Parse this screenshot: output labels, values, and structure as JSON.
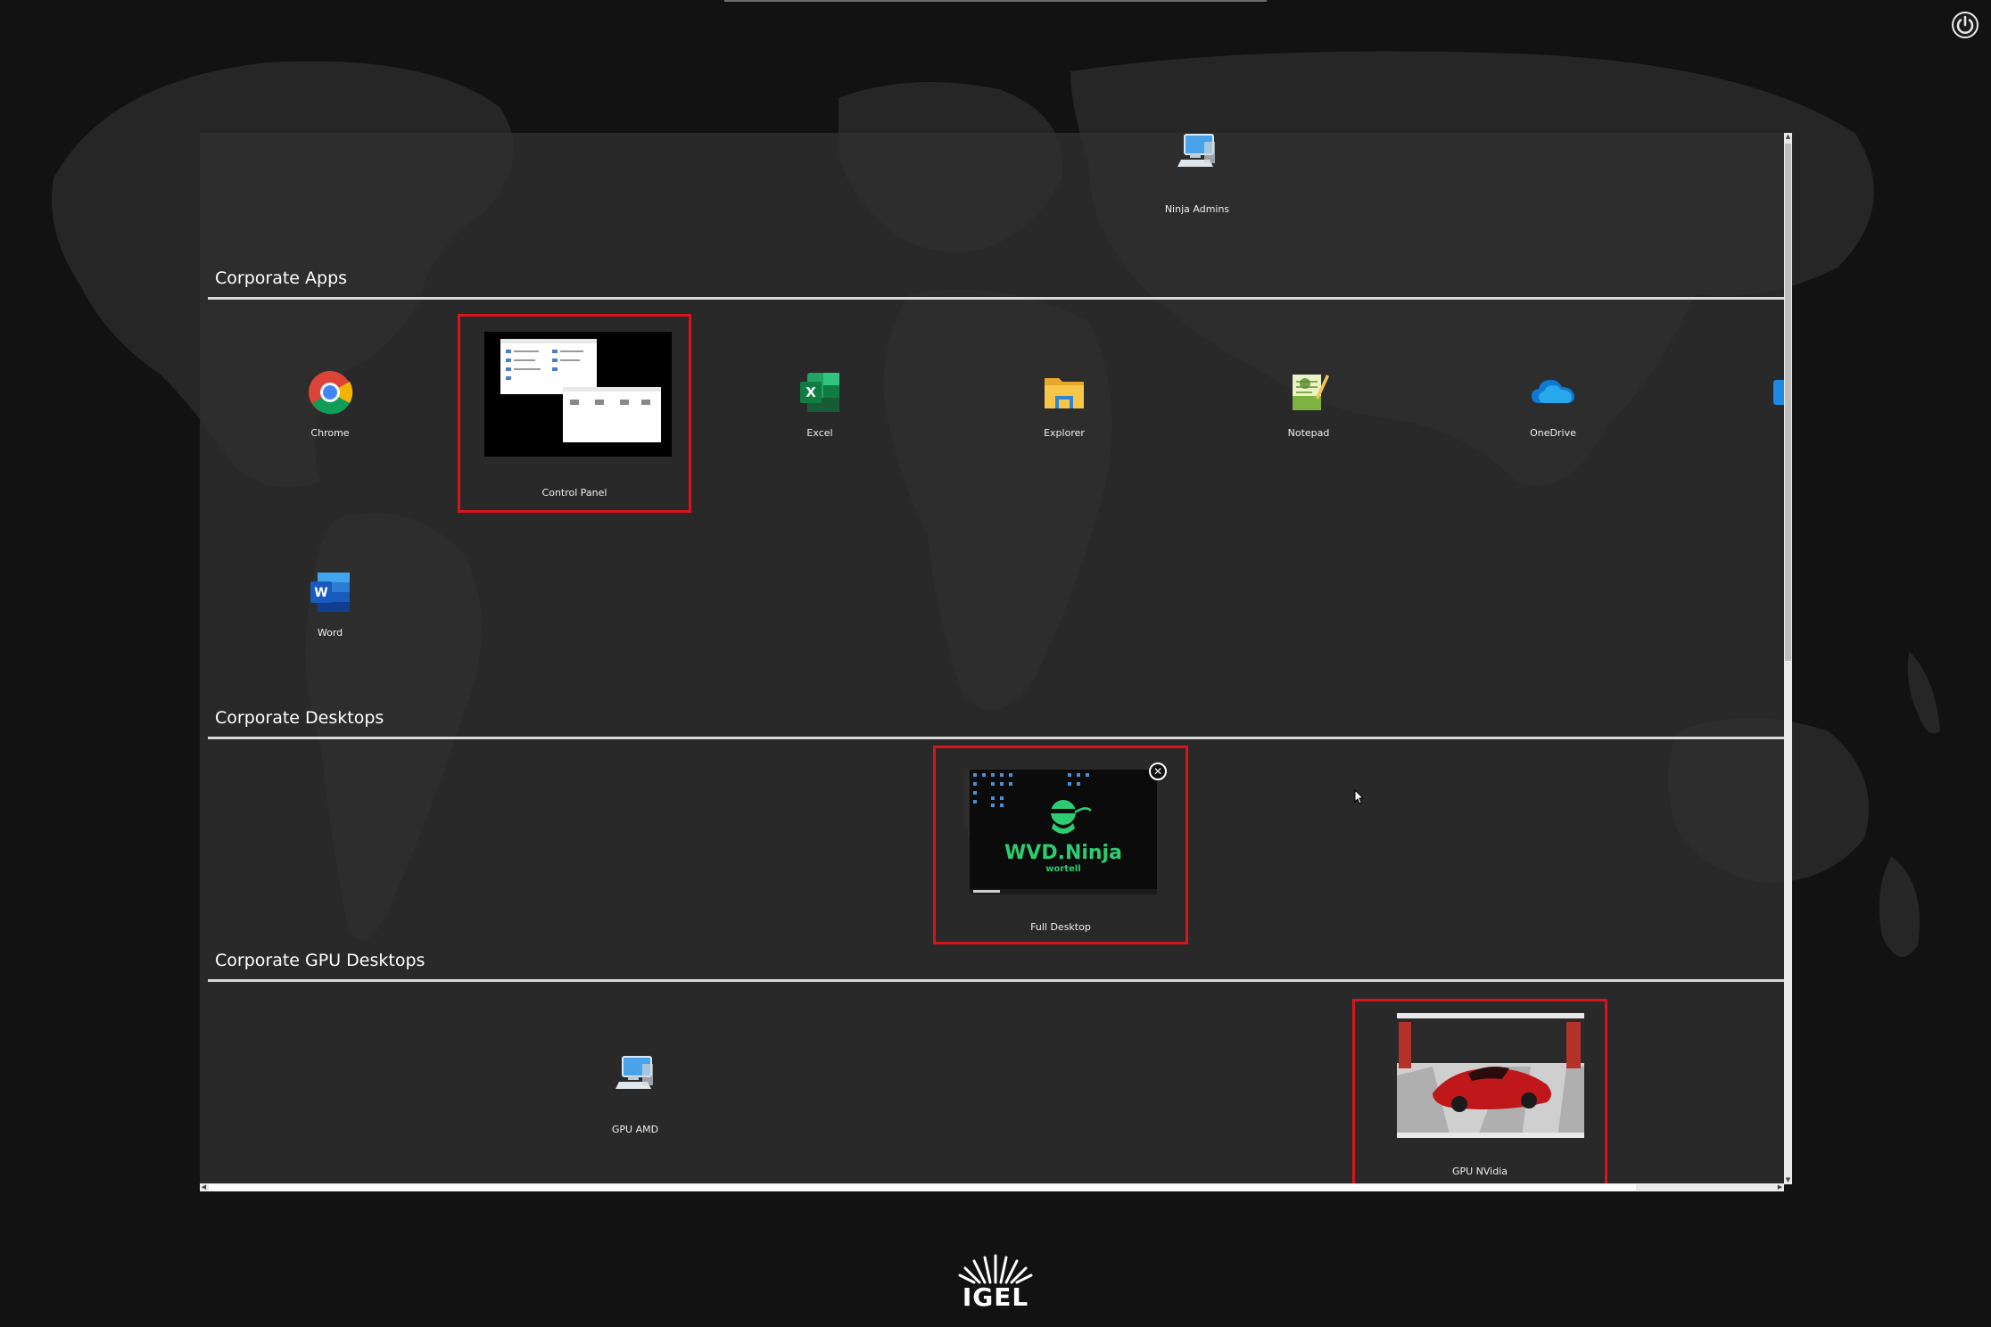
{
  "top_group": {
    "label": "Ninja Admins",
    "icon": "computer-icon"
  },
  "sections": [
    {
      "title": "Corporate Apps"
    },
    {
      "title": "Corporate Desktops"
    },
    {
      "title": "Corporate GPU Desktops"
    }
  ],
  "apps": [
    {
      "label": "Chrome",
      "icon": "chrome-icon"
    },
    {
      "label": "Control Panel",
      "icon": "control-panel-thumbnail"
    },
    {
      "label": "Excel",
      "icon": "excel-icon"
    },
    {
      "label": "Explorer",
      "icon": "explorer-icon"
    },
    {
      "label": "Notepad",
      "icon": "notepad-icon"
    },
    {
      "label": "OneDrive",
      "icon": "onedrive-icon"
    },
    {
      "label": "Word",
      "icon": "word-icon"
    }
  ],
  "desktops": [
    {
      "label": "Full Desktop",
      "thumbnail_text": "WVD.Ninja",
      "thumbnail_subtext": "wortell",
      "close": "✕"
    }
  ],
  "gpu_desktops": [
    {
      "label": "GPU AMD",
      "icon": "computer-icon"
    },
    {
      "label": "GPU NVidia",
      "icon": "red-car-thumbnail"
    }
  ],
  "logo": {
    "text": "IGEL"
  },
  "colors": {
    "highlight": "#d8141d",
    "panel": "#303030",
    "background": "#121212"
  }
}
